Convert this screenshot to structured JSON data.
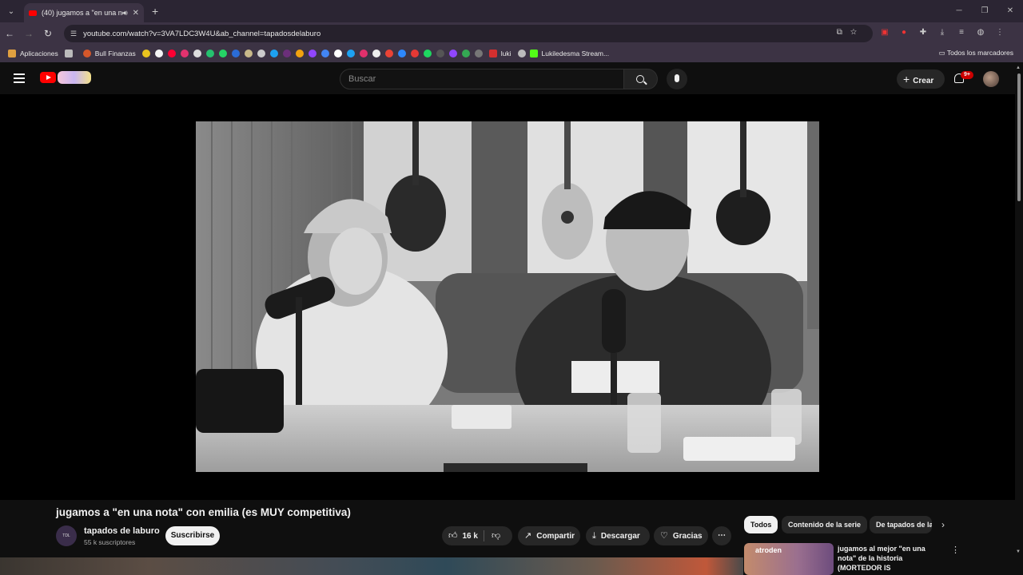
{
  "browser": {
    "tab_title": "(40) jugamos a \"en una no…",
    "url": "youtube.com/watch?v=3VA7LDC3W4U&ab_channel=tapadosdelaburo",
    "bookmarks": [
      "Aplicaciones",
      "Bull Finanzas",
      "luki",
      "Lukiledesma Stream..."
    ],
    "all_bookmarks": "Todos los marcadores"
  },
  "youtube": {
    "search_placeholder": "Buscar",
    "create_label": "Crear",
    "notif_badge": "9+"
  },
  "video": {
    "title": "jugamos a \"en una nota\" con emilia (es MUY competitiva)",
    "channel_name": "tapados de laburo",
    "subscribers": "55 k suscriptores",
    "subscribe_label": "Suscribirse",
    "likes": "16 k",
    "share_label": "Compartir",
    "download_label": "Descargar",
    "thanks_label": "Gracias"
  },
  "chips": [
    "Todos",
    "Contenido de la serie",
    "De tapados de la"
  ],
  "recommendation": {
    "thumb_text": "atroden",
    "title": "jugamos al mejor \"en una nota\" de la historia (MORTEDOR IS"
  }
}
